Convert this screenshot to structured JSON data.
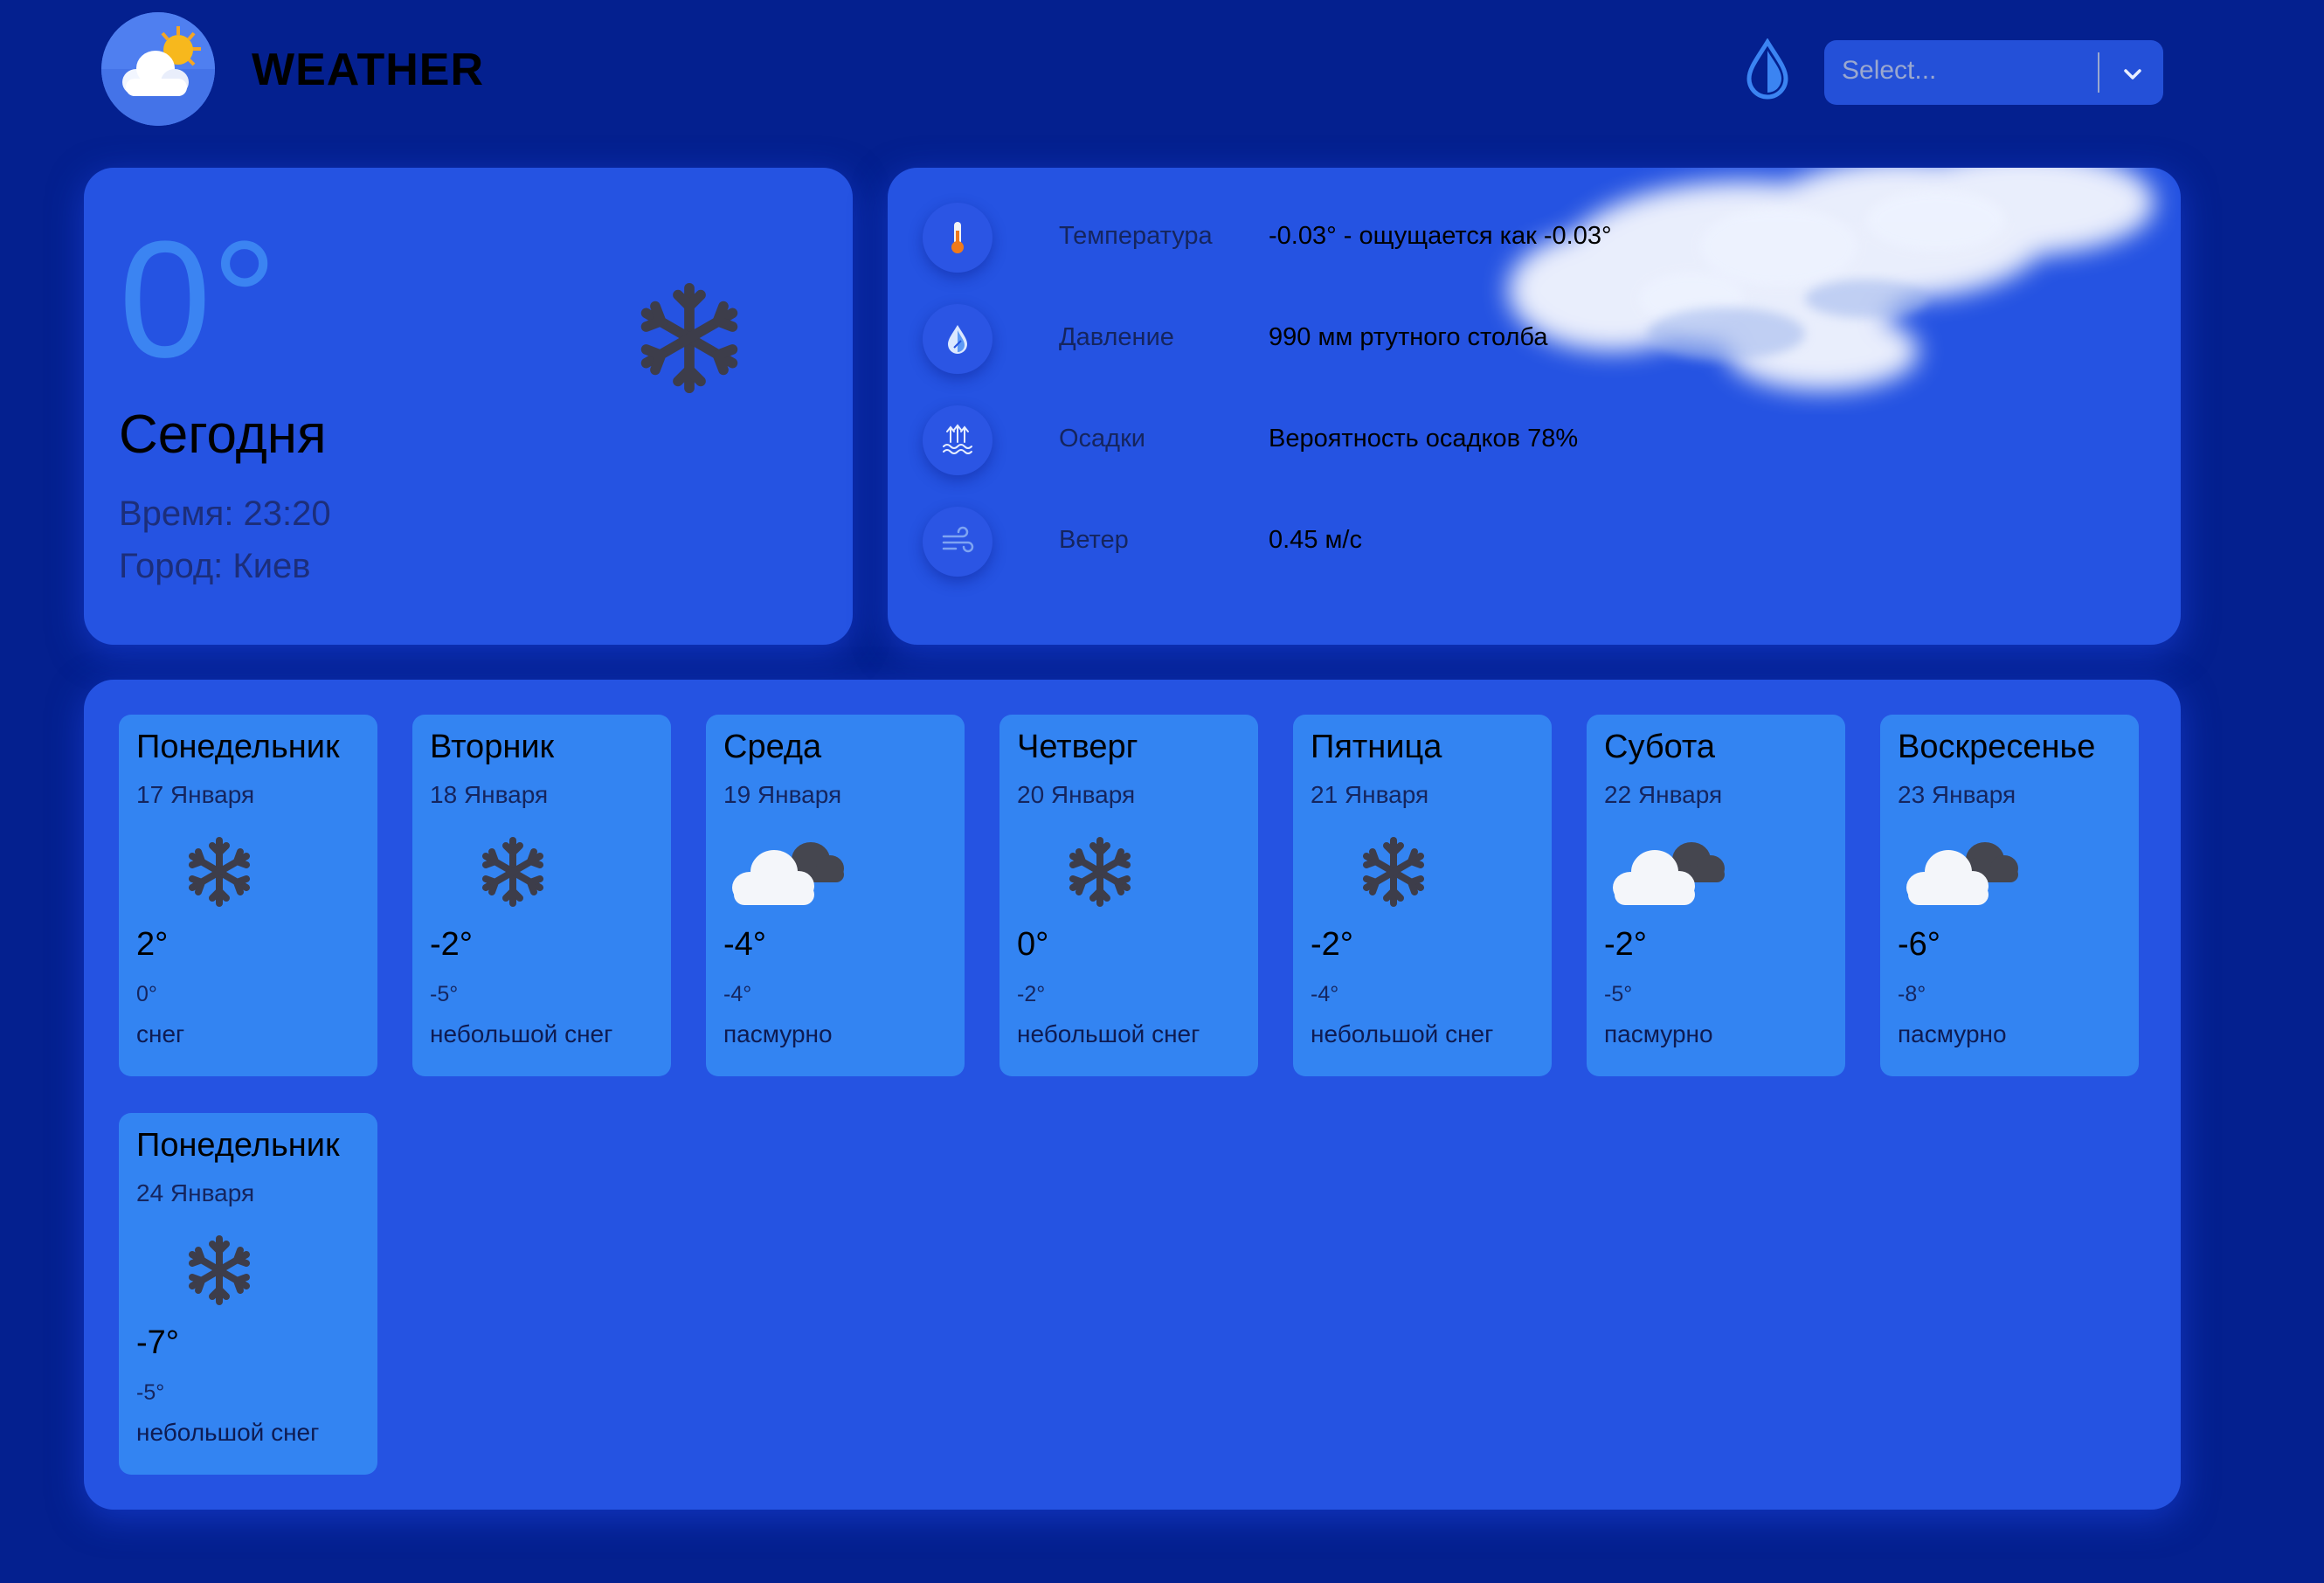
{
  "header": {
    "title": "WEATHER",
    "logo_icon": "sun-cloud-icon",
    "theme_icon": "water-drop-icon",
    "select_placeholder": "Select...",
    "select_icon": "chevron-down-icon"
  },
  "today": {
    "temperature": "0°",
    "label": "Сегодня",
    "time": "Время: 23:20",
    "city": "Город: Киев",
    "icon": "snowflake-icon"
  },
  "details": [
    {
      "icon": "thermometer-icon",
      "label": "Температура",
      "value": "-0.03° - ощущается как -0.03°"
    },
    {
      "icon": "pressure-drop-icon",
      "label": "Давление",
      "value": "990 мм ртутного столба"
    },
    {
      "icon": "precipitation-icon",
      "label": "Осадки",
      "value": "Вероятность осадков 78%"
    },
    {
      "icon": "wind-icon",
      "label": "Ветер",
      "value": "0.45 м/с"
    }
  ],
  "forecast": [
    {
      "day": "Понедельник",
      "date": "17 Января",
      "icon": "snowflake-icon",
      "temp": "2°",
      "min": "0°",
      "desc": "снег"
    },
    {
      "day": "Вторник",
      "date": "18 Января",
      "icon": "snowflake-icon",
      "temp": "-2°",
      "min": "-5°",
      "desc": "небольшой снег"
    },
    {
      "day": "Среда",
      "date": "19 Января",
      "icon": "overcast-clouds-icon",
      "temp": "-4°",
      "min": "-4°",
      "desc": "пасмурно"
    },
    {
      "day": "Четверг",
      "date": "20 Января",
      "icon": "snowflake-icon",
      "temp": "0°",
      "min": "-2°",
      "desc": "небольшой снег"
    },
    {
      "day": "Пятница",
      "date": "21 Января",
      "icon": "snowflake-icon",
      "temp": "-2°",
      "min": "-4°",
      "desc": "небольшой снег"
    },
    {
      "day": "Субота",
      "date": "22 Января",
      "icon": "overcast-clouds-icon",
      "temp": "-2°",
      "min": "-5°",
      "desc": "пасмурно"
    },
    {
      "day": "Воскресенье",
      "date": "23 Января",
      "icon": "overcast-clouds-icon",
      "temp": "-6°",
      "min": "-8°",
      "desc": "пасмурно"
    },
    {
      "day": "Понедельник",
      "date": "24 Января",
      "icon": "snowflake-icon",
      "temp": "-7°",
      "min": "-5°",
      "desc": "небольшой снег"
    }
  ],
  "colors": {
    "background": "#04208f",
    "card": "#2553e2",
    "day_card": "#3384f2",
    "accent_temp": "#3b84f2"
  }
}
